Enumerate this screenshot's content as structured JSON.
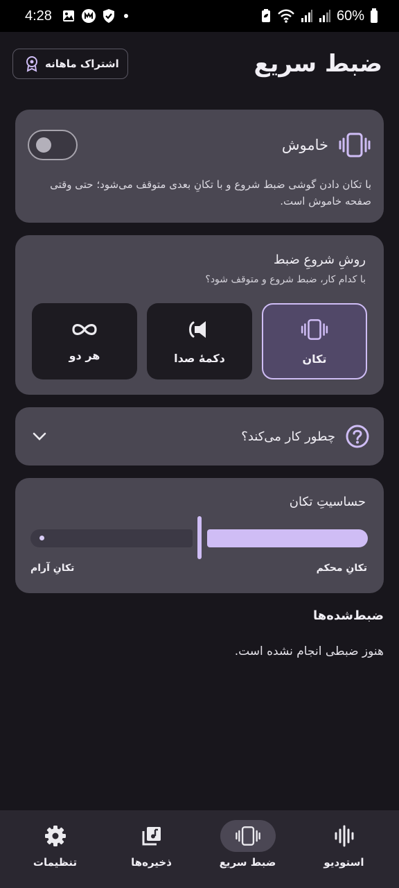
{
  "status_bar": {
    "time": "4:28",
    "battery": "60%",
    "icons": [
      "gallery-icon",
      "m-app-icon",
      "shield-check-icon",
      "dot-icon",
      "battery-saver-icon",
      "wifi-icon",
      "signal-icon",
      "signal-icon",
      "battery-icon"
    ]
  },
  "header": {
    "title": "ضبط سریع",
    "subscription_label": "اشتراک ماهانه"
  },
  "shake_card": {
    "state_label": "خاموش",
    "description": "با تکان دادن گوشی ضبط شروع و با تکانِ بعدی متوقف می‌شود؛ حتی وقتی صفحه خاموش است.",
    "toggle_on": false
  },
  "method_card": {
    "title": "روشِ شروعِ ضبط",
    "subtitle": "با کدام کار، ضبط شروع و متوقف شود؟",
    "options": [
      {
        "label": "تکان",
        "icon": "vibrate-icon",
        "selected": true
      },
      {
        "label": "دکمهٔ صدا",
        "icon": "volume-button-icon",
        "selected": false
      },
      {
        "label": "هر دو",
        "icon": "infinity-icon",
        "selected": false
      }
    ]
  },
  "how_card": {
    "label": "چطور کار می‌کند؟"
  },
  "sensitivity_card": {
    "title": "حساسیتِ تکان",
    "strong_label": "تکانِ محکم",
    "calm_label": "تکانِ آرام",
    "level": 0.5
  },
  "recordings": {
    "title": "ضبط‌شده‌ها",
    "empty_text": "هنوز ضبطی انجام نشده است."
  },
  "nav": {
    "items": [
      {
        "label": "استودیو",
        "icon": "waveform-icon",
        "active": false
      },
      {
        "label": "ضبط سریع",
        "icon": "vibrate-icon",
        "active": true
      },
      {
        "label": "ذخیره‌ها",
        "icon": "library-music-icon",
        "active": false
      },
      {
        "label": "تنظیمات",
        "icon": "gear-icon",
        "active": false
      }
    ]
  },
  "colors": {
    "background": "#18161c",
    "card": "#4a4752",
    "accent": "#cfbdf5",
    "selected_option": "#514868",
    "option": "#1d1b21",
    "nav": "#2a2730"
  }
}
